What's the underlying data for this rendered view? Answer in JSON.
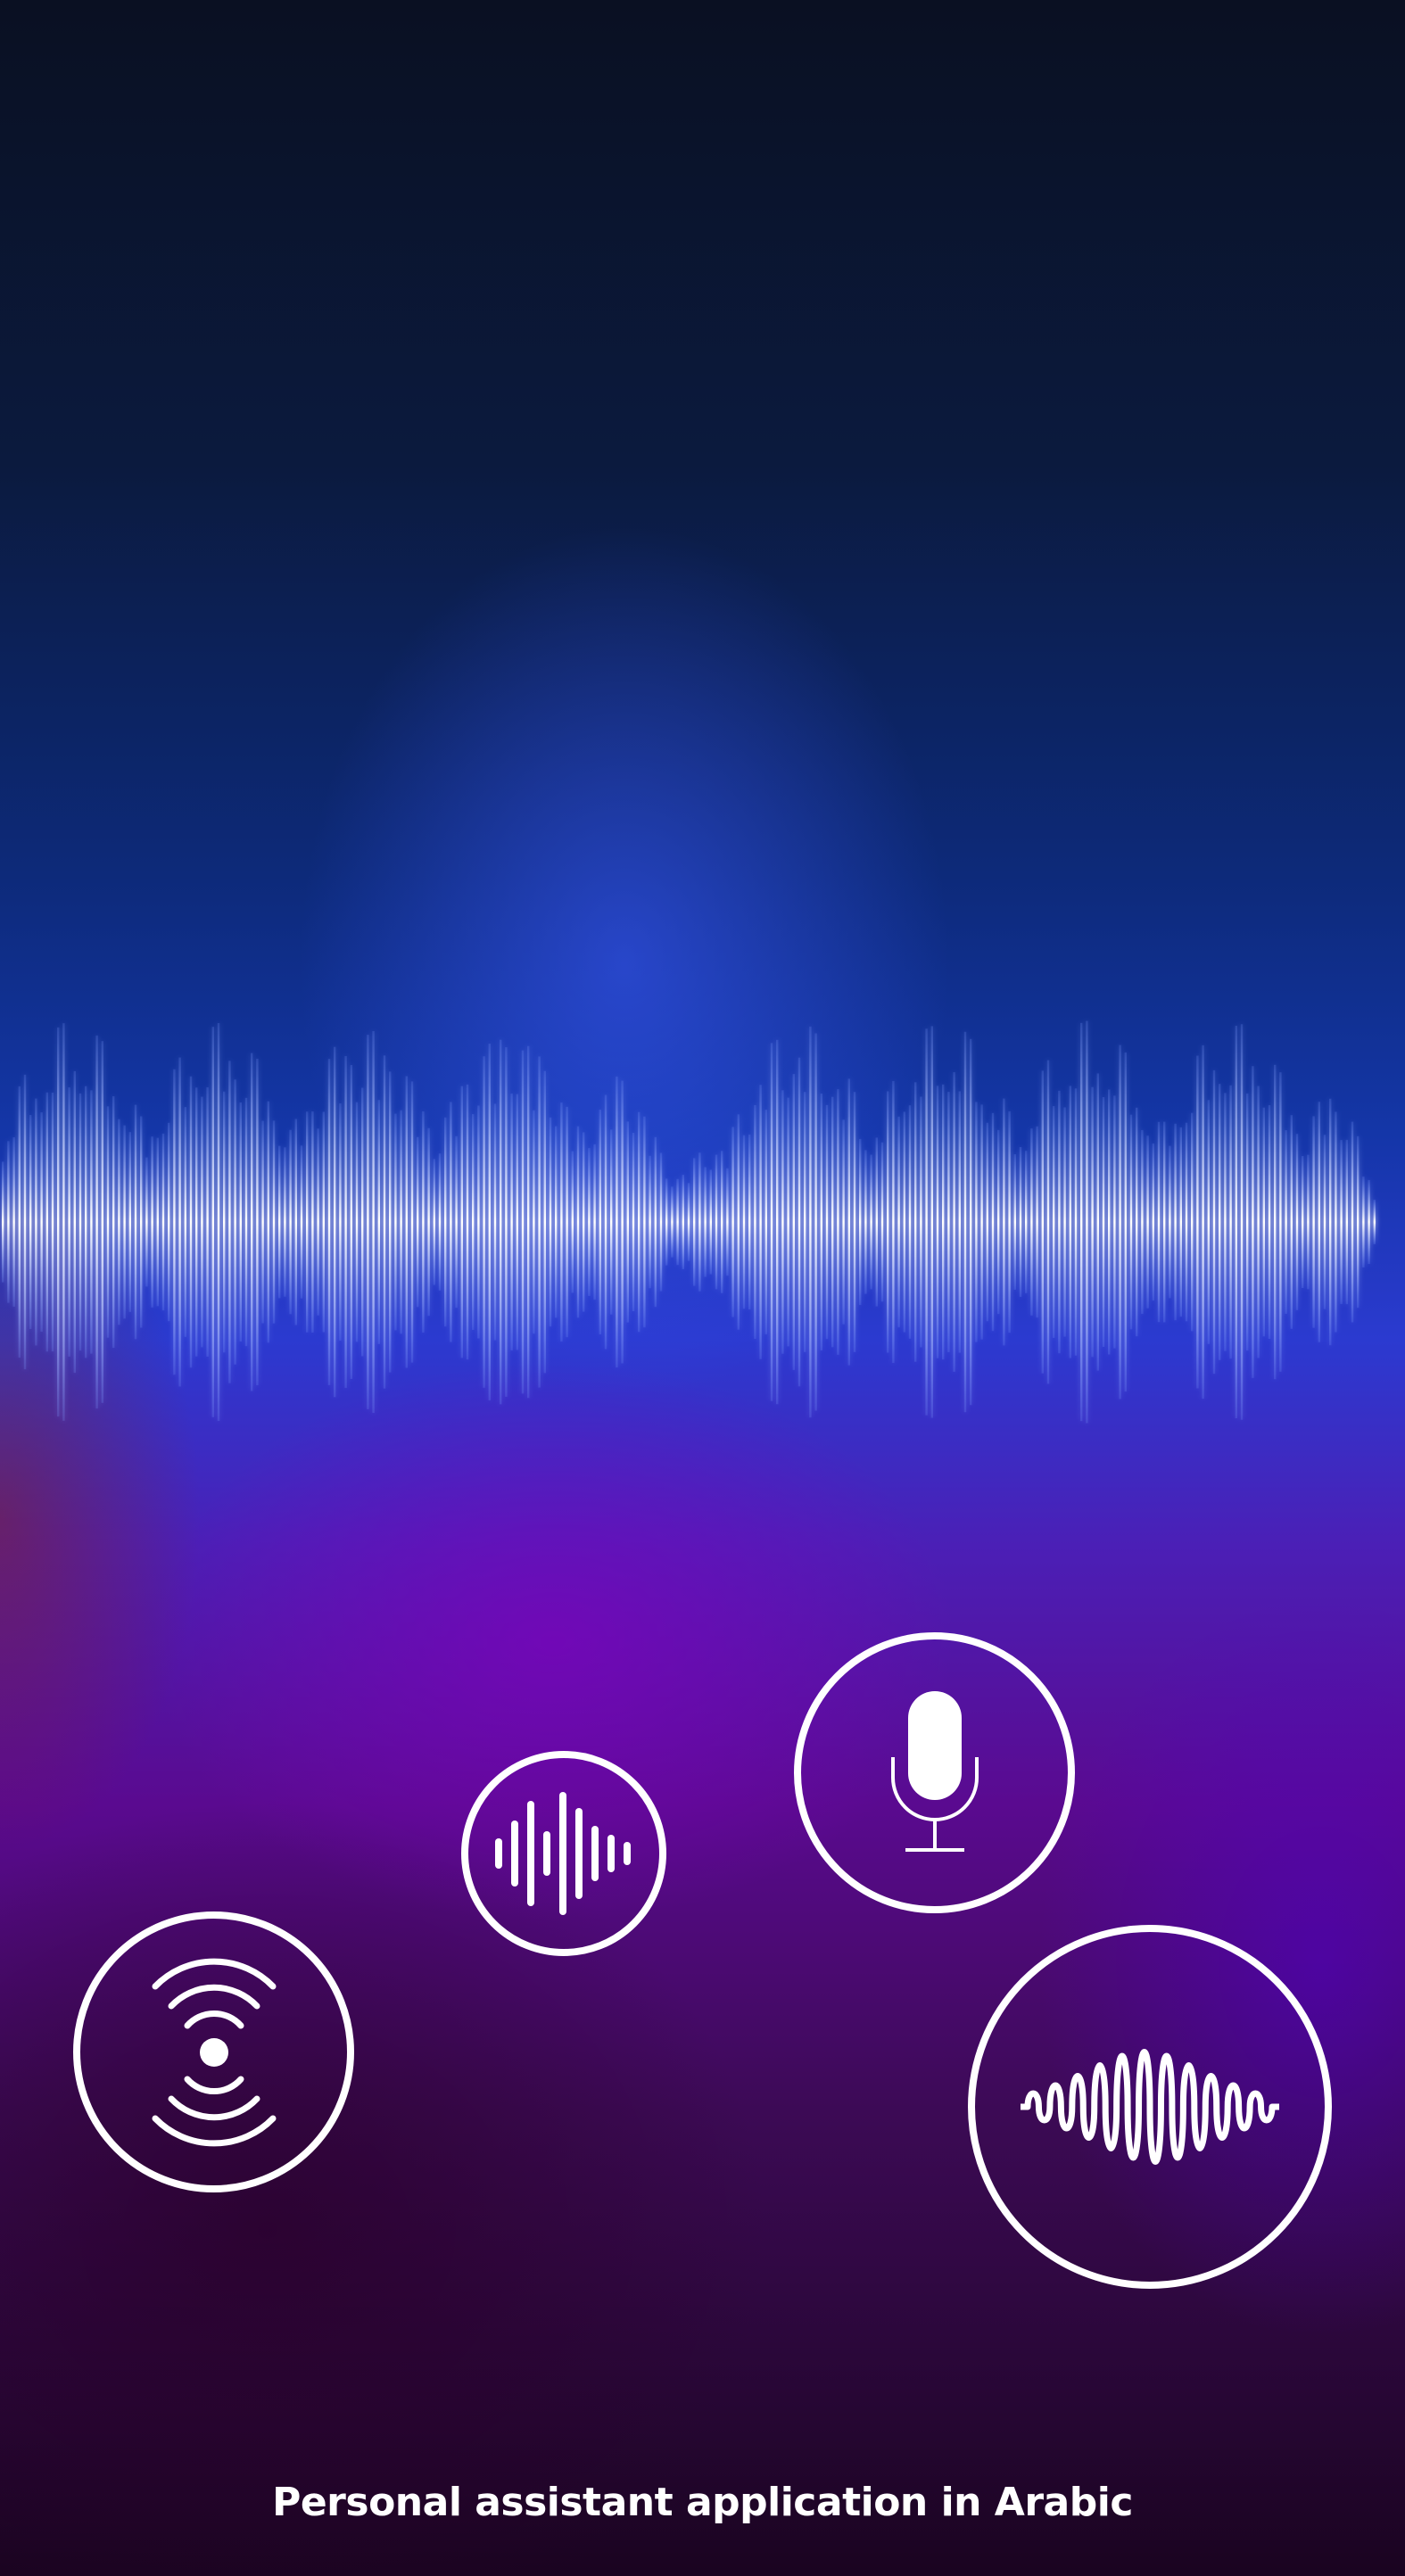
{
  "caption": "Personal assistant application in Arabic",
  "icons": [
    {
      "name": "microphone-icon"
    },
    {
      "name": "audio-bars-icon"
    },
    {
      "name": "broadcast-signal-icon"
    },
    {
      "name": "sound-wave-icon"
    }
  ],
  "colors": {
    "icon_stroke": "#ffffff",
    "wave_core": "#ffffff",
    "wave_glow": "#8fb0ff"
  }
}
